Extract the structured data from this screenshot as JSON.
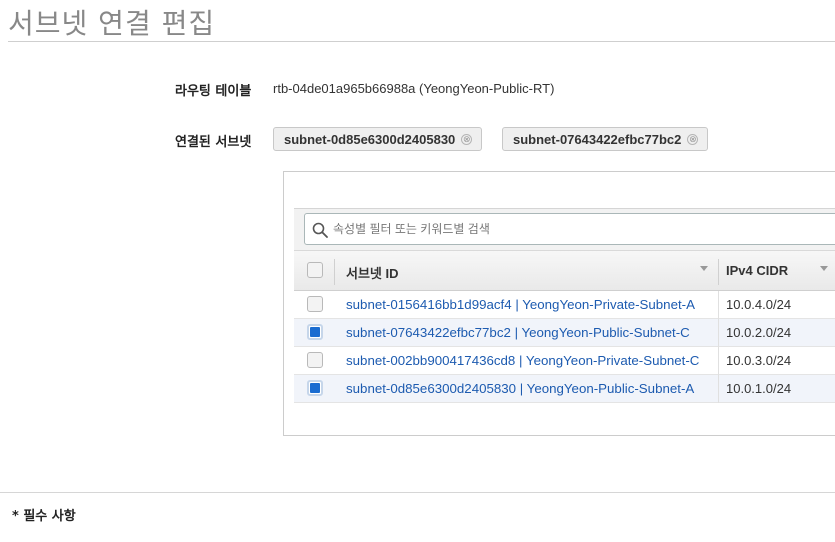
{
  "page": {
    "title": "서브넷 연결 편집"
  },
  "route_table": {
    "label": "라우팅 테이블",
    "value": "rtb-04de01a965b66988a (YeongYeon-Public-RT)"
  },
  "associated": {
    "label": "연결된 서브넷",
    "tokens": [
      {
        "text": "subnet-0d85e6300d2405830"
      },
      {
        "text": "subnet-07643422efbc77bc2"
      }
    ],
    "remove_glyph": "⊗"
  },
  "filter": {
    "placeholder": "속성별 필터 또는 키워드별 검색",
    "icon": "search-icon"
  },
  "table": {
    "columns": [
      {
        "label": "서브넷 ID"
      },
      {
        "label": "IPv4 CIDR"
      }
    ],
    "rows": [
      {
        "subnet": "subnet-0156416bb1d99acf4 | YeongYeon-Private-Subnet-A",
        "cidr": "10.0.4.0/24",
        "checked": false
      },
      {
        "subnet": "subnet-07643422efbc77bc2 | YeongYeon-Public-Subnet-C",
        "cidr": "10.0.2.0/24",
        "checked": true
      },
      {
        "subnet": "subnet-002bb900417436cd8 | YeongYeon-Private-Subnet-C",
        "cidr": "10.0.3.0/24",
        "checked": false
      },
      {
        "subnet": "subnet-0d85e6300d2405830 | YeongYeon-Public-Subnet-A",
        "cidr": "10.0.1.0/24",
        "checked": true
      }
    ]
  },
  "footer": {
    "required_note": "* 필수 사항"
  },
  "colors": {
    "link": "#1d5bb0",
    "checkbox_checked": "#1a6cd1",
    "selected_row": "#f1f4fa"
  }
}
